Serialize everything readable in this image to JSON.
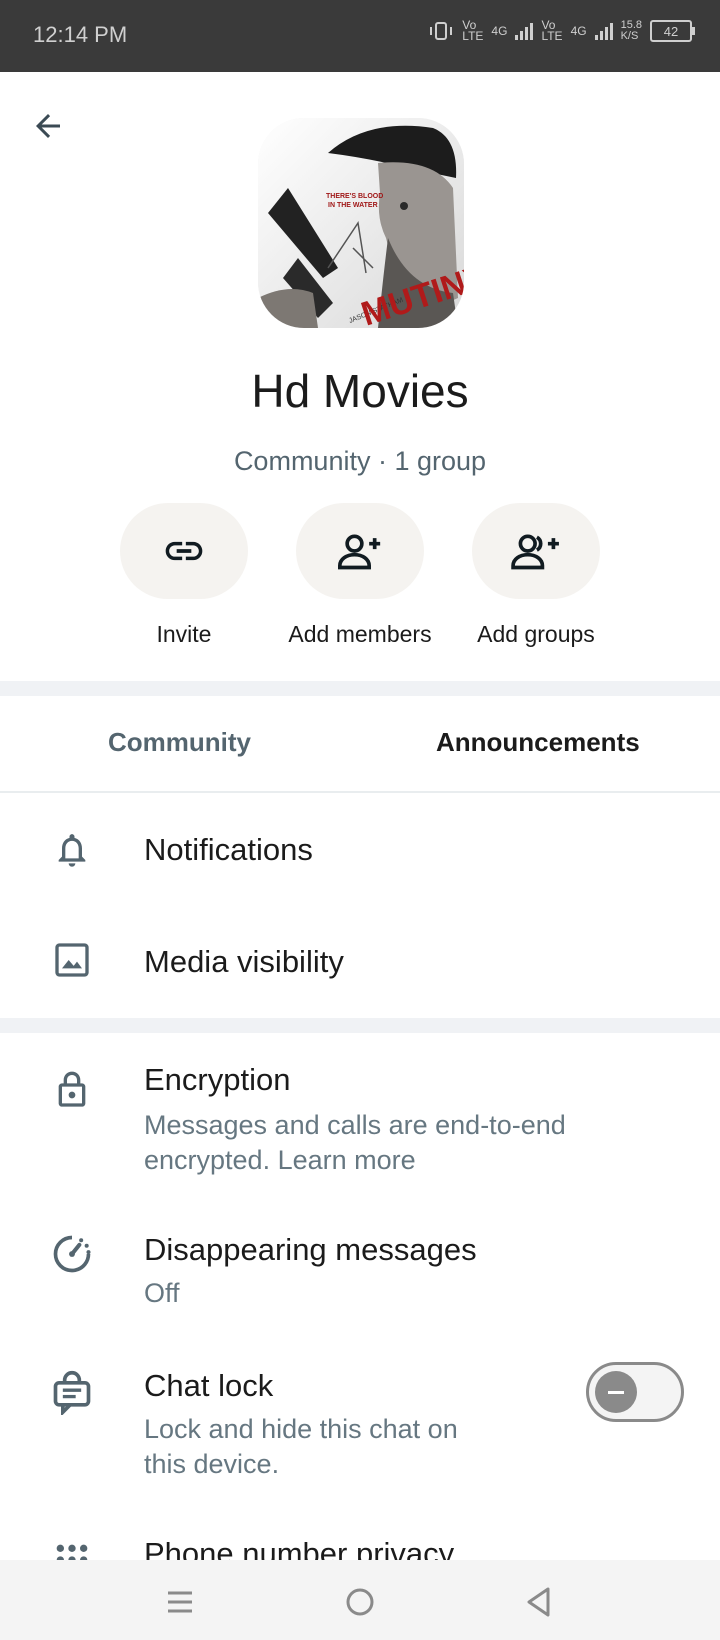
{
  "status_bar": {
    "time": "12:14 PM",
    "net1_top": "Vo",
    "net1_bottom": "LTE",
    "net2_top": "4G",
    "net3_top": "Vo",
    "net3_bottom": "LTE",
    "net4_top": "4G",
    "speed_top": "15.8",
    "speed_bottom": "K/S",
    "battery": "42"
  },
  "header": {
    "back_icon": "arrow-left-icon",
    "title": "Hd Movies",
    "subtitle": "Community · 1 group"
  },
  "poster": {
    "tagline_line1": "THERE'S BLOOD",
    "tagline_line2": "IN THE WATER",
    "actor": "JASON STATHAM",
    "word": "MUTINY"
  },
  "actions": [
    {
      "label": "Invite",
      "icon": "link-icon"
    },
    {
      "label": "Add members",
      "icon": "add-person-icon"
    },
    {
      "label": "Add groups",
      "icon": "add-group-icon"
    }
  ],
  "tabs": [
    {
      "label": "Community",
      "selected": false
    },
    {
      "label": "Announcements",
      "selected": true
    }
  ],
  "settings": {
    "notifications": {
      "title": "Notifications",
      "icon": "bell-icon"
    },
    "media_visibility": {
      "title": "Media visibility",
      "icon": "image-icon"
    },
    "encryption": {
      "title": "Encryption",
      "line1": "Messages and calls are end-to-end",
      "line2": "encrypted. Learn more",
      "icon": "lock-icon"
    },
    "disappearing": {
      "title": "Disappearing messages",
      "value": "Off",
      "icon": "timer-icon"
    },
    "chat_lock": {
      "title": "Chat lock",
      "line1": "Lock and hide this chat on",
      "line2": "this device.",
      "enabled": false,
      "icon": "chat-lock-icon"
    },
    "phone_privacy": {
      "title": "Phone number privacy",
      "icon": "dialpad-icon"
    }
  },
  "colors": {
    "accent": "#111b21",
    "secondary_text": "#667781",
    "button_bg": "#f5f3f0",
    "divider": "#f0f2f5"
  }
}
